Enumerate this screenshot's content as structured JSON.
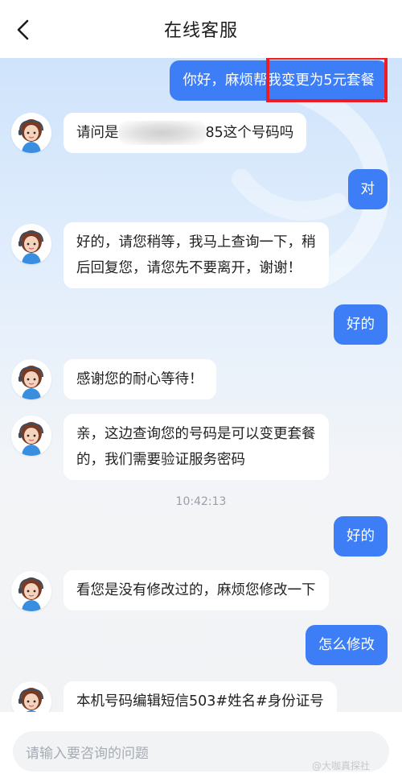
{
  "header": {
    "title": "在线客服",
    "back_icon": "chevron-left-icon"
  },
  "messages": [
    {
      "side": "out",
      "text": "你好，麻烦帮我变更为5元套餐"
    },
    {
      "side": "in",
      "prefix": "请问是",
      "suffix": "85这个号码吗"
    },
    {
      "side": "out",
      "text": "对"
    },
    {
      "side": "in",
      "lines": [
        "好的，请您稍等，我马上查询一下，稍",
        "后回复您，请您先不要离开，谢谢！"
      ]
    },
    {
      "side": "out",
      "text": "好的"
    },
    {
      "side": "in",
      "text": "感谢您的耐心等待！"
    },
    {
      "side": "in",
      "lines": [
        "亲，这边查询您的号码是可以变更套餐",
        "的，我们需要验证服务密码"
      ]
    },
    {
      "side": "out",
      "text": "好的"
    },
    {
      "side": "in",
      "text": "看您是没有修改过的，麻烦您修改一下"
    },
    {
      "side": "out",
      "text": "怎么修改"
    },
    {
      "side": "in",
      "text": "本机号码编辑短信503#姓名#身份证号"
    }
  ],
  "timestamp": "10:42:13",
  "input": {
    "placeholder": "请输入要咨询的问题"
  },
  "watermark": "@大咖真探社",
  "colors": {
    "accent": "#3d7ef6",
    "highlight": "#ee1c25"
  }
}
